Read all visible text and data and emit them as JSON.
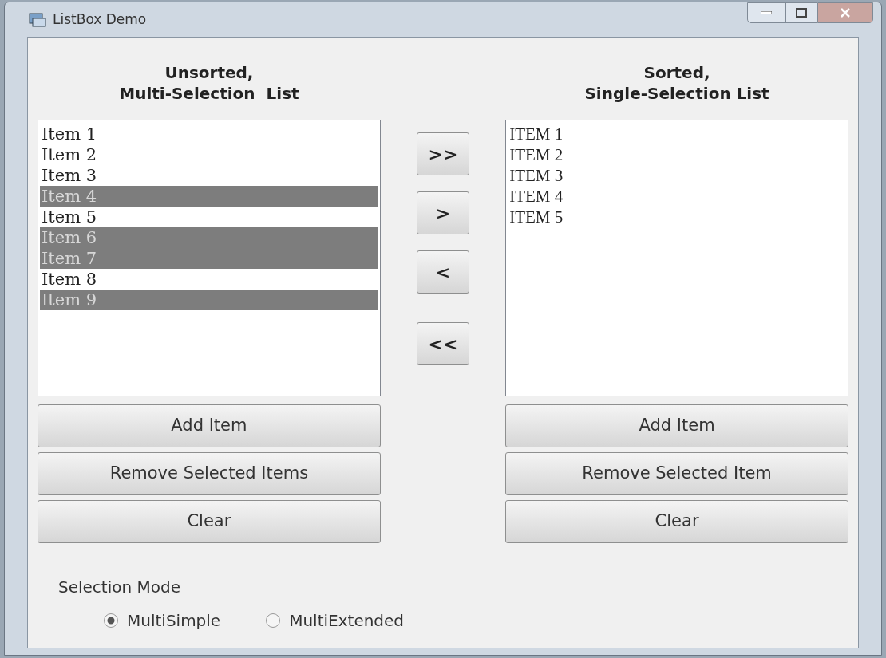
{
  "window": {
    "title": "ListBox Demo"
  },
  "left": {
    "heading": [
      "Unsorted,",
      "Multi-Selection  List"
    ],
    "items": [
      {
        "label": "Item 1",
        "selected": false
      },
      {
        "label": "Item 2",
        "selected": false
      },
      {
        "label": "Item 3",
        "selected": false
      },
      {
        "label": "Item 4",
        "selected": true
      },
      {
        "label": "Item 5",
        "selected": false
      },
      {
        "label": "Item 6",
        "selected": true
      },
      {
        "label": "Item 7",
        "selected": true
      },
      {
        "label": "Item 8",
        "selected": false
      },
      {
        "label": "Item 9",
        "selected": true
      }
    ],
    "buttons": [
      "Add Item",
      "Remove Selected Items",
      "Clear"
    ]
  },
  "transfer_buttons": [
    ">>",
    ">",
    "<",
    "<<"
  ],
  "right": {
    "heading": [
      "Sorted,",
      "Single-Selection List"
    ],
    "items": [
      {
        "label": "ITEM 1",
        "selected": false
      },
      {
        "label": "ITEM 2",
        "selected": false
      },
      {
        "label": "ITEM 3",
        "selected": false
      },
      {
        "label": "ITEM 4",
        "selected": false
      },
      {
        "label": "ITEM 5",
        "selected": false
      }
    ],
    "buttons": [
      "Add Item",
      "Remove Selected Item",
      "Clear"
    ]
  },
  "selection_mode": {
    "label": "Selection Mode",
    "options": [
      {
        "label": "MultiSimple",
        "selected": true
      },
      {
        "label": "MultiExtended",
        "selected": false
      }
    ]
  }
}
